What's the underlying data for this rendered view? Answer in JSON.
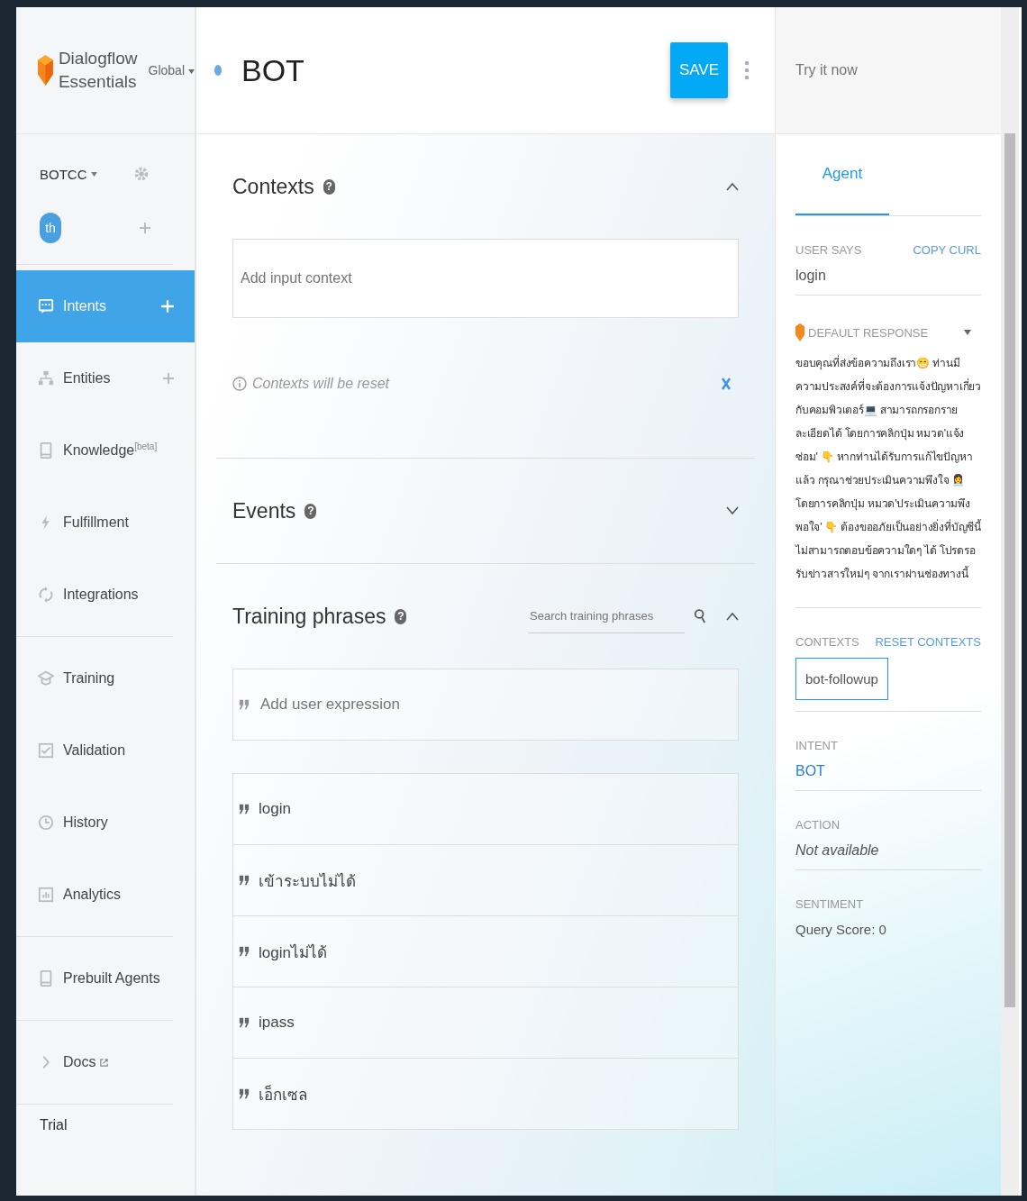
{
  "brand": {
    "name_line1": "Dialogflow",
    "name_line2": "Essentials",
    "region": "Global"
  },
  "agent": {
    "name": "BOTCC",
    "language": "th"
  },
  "sidebar": {
    "groups": [
      [
        {
          "label": "Intents",
          "selected": true,
          "add": true
        },
        {
          "label": "Entities",
          "selected": false,
          "add": true
        },
        {
          "label": "Knowledge$^{[beta]}$",
          "selected": false,
          "add": false
        },
        {
          "label": "Fulfillment",
          "selected": false,
          "add": false
        },
        {
          "label": "Integrations",
          "selected": false,
          "add": false
        }
      ],
      [
        {
          "label": "Training",
          "selected": false,
          "add": false
        },
        {
          "label": "Validation",
          "selected": false,
          "add": false
        },
        {
          "label": "History",
          "selected": false,
          "add": false
        },
        {
          "label": "Analytics",
          "selected": false,
          "add": false
        }
      ],
      [
        {
          "label": "Prebuilt Agents",
          "selected": false,
          "add": false
        }
      ],
      [
        {
          "label": "Docs",
          "selected": false,
          "add": false,
          "external": true
        }
      ]
    ],
    "footer": "Trial"
  },
  "help_icon": "?",
  "intent": {
    "title": "BOT",
    "save": "SAVE"
  },
  "contexts": {
    "title": "Contexts",
    "expanded": true,
    "input_placeholder": "Add input context",
    "notice": "Contexts will be reset"
  },
  "events": {
    "title": "Events",
    "expanded": false
  },
  "training": {
    "title": "Training phrases",
    "expanded": true,
    "search_placeholder": "Search training phrases",
    "add_placeholder": "Add user expression",
    "phrases": [
      "login",
      "เข้าระบบไม่ได้",
      "loginไม่ได้",
      "ipass",
      "เอ็กเซล"
    ]
  },
  "console": {
    "try_placeholder": "Try it now",
    "tab": "Agent",
    "user_says_label": "USER SAYS",
    "copy_curl": "COPY CURL",
    "user_says": "login",
    "response_label": "DEFAULT RESPONSE",
    "response": "ขอบคุณที่ส่งข้อความถึงเรา😁 ท่านมีความประสงค์ที่จะต้องการแจ้งปัญหาเกี่ยวกับคอมพิวเตอร์💻 สามารถกรอกรายละเอียดได้ โดยการคลิกปุ่ม หมวด'แจ้งซ่อม' 👇 หากท่านได้รับการแก้ไขปัญหาแล้ว กรุณาช่วยประเมินความพึงใจ 👩‍💼 โดยการคลิกปุ่ม หมวด'ประเมินความพึงพอใจ' 👇 ต้องขออภัยเป็นอย่างยิ่งที่บัญชีนี้ไม่สามารถตอบข้อความใดๆ ได้ โปรดรอรับข่าวสารใหม่ๆ จากเราผ่านช่องทางนี้",
    "contexts_label": "CONTEXTS",
    "reset_contexts": "RESET CONTEXTS",
    "context_chips": [
      "bot-followup"
    ],
    "intent_label": "INTENT",
    "intent_value": "BOT",
    "action_label": "ACTION",
    "action_value": "Not available",
    "sentiment_label": "SENTIMENT",
    "sentiment_value": "Query Score: 0"
  }
}
